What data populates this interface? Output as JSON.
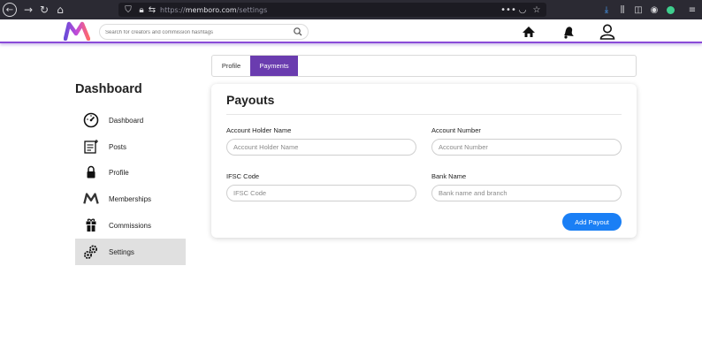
{
  "browser": {
    "url_scheme": "https://",
    "url_host": "memboro.com",
    "url_path": "/settings"
  },
  "header": {
    "search_placeholder": "Search for creators and commission hashtags",
    "brand_color": "#6a3caf"
  },
  "sidebar": {
    "title": "Dashboard",
    "items": [
      {
        "label": "Dashboard",
        "icon": "speedometer-icon"
      },
      {
        "label": "Posts",
        "icon": "posts-icon"
      },
      {
        "label": "Profile",
        "icon": "lock-icon"
      },
      {
        "label": "Memberships",
        "icon": "memberships-icon"
      },
      {
        "label": "Commissions",
        "icon": "gift-icon"
      },
      {
        "label": "Settings",
        "icon": "gears-icon",
        "active": true
      }
    ]
  },
  "tabs": [
    {
      "label": "Profile",
      "active": false
    },
    {
      "label": "Payments",
      "active": true
    }
  ],
  "payouts": {
    "title": "Payouts",
    "fields": {
      "account_holder": {
        "label": "Account Holder Name",
        "placeholder": "Account Holder Name"
      },
      "account_number": {
        "label": "Account Number",
        "placeholder": "Account Number"
      },
      "ifsc": {
        "label": "IFSC Code",
        "placeholder": "IFSC Code"
      },
      "bank_name": {
        "label": "Bank Name",
        "placeholder": "Bank name and branch"
      }
    },
    "submit_label": "Add Payout",
    "submit_color": "#1a7ff5"
  }
}
